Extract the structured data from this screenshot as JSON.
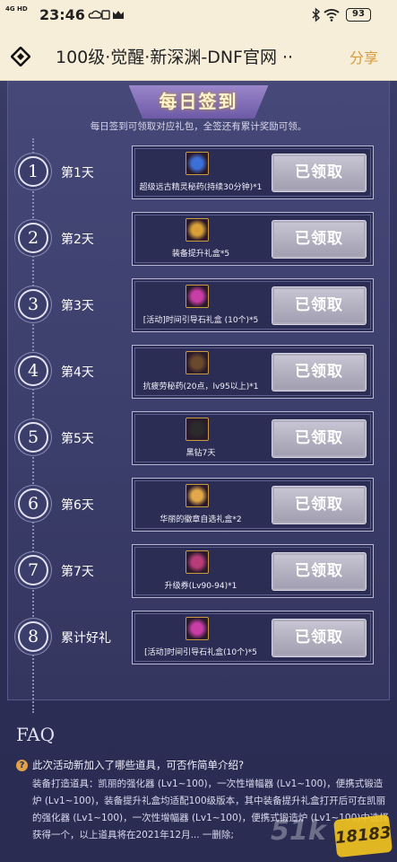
{
  "status_bar": {
    "signal": "4G HD",
    "time": "23:46",
    "battery": "93"
  },
  "title_bar": {
    "title": "100级·觉醒·新深渊-DNF官网 ··",
    "share_label": "分享"
  },
  "checkin": {
    "heading": "每日签到",
    "subtitle": "每日签到可领取对应礼包，全签还有累计奖励可领。",
    "days": [
      {
        "number": "1",
        "label": "第1天",
        "item": "超级远古精灵秘药(持续30分钟)*1",
        "button": "已领取",
        "icon_color": "#3d6fd9"
      },
      {
        "number": "2",
        "label": "第2天",
        "item": "装备提升礼盒*5",
        "button": "已领取",
        "icon_color": "#d9a037"
      },
      {
        "number": "3",
        "label": "第3天",
        "item": "[活动]时间引导石礼盒 (10个)*5",
        "button": "已领取",
        "icon_color": "#c93ea6"
      },
      {
        "number": "4",
        "label": "第4天",
        "item": "抗疲劳秘药(20点，lv95以上)*1",
        "button": "已领取",
        "icon_color": "#6a4a2c"
      },
      {
        "number": "5",
        "label": "第5天",
        "item": "黑钻7天",
        "button": "已领取",
        "icon_color": "#2b2b2b"
      },
      {
        "number": "6",
        "label": "第6天",
        "item": "华丽的徽章自选礼盒*2",
        "button": "已领取",
        "icon_color": "#e0a84a"
      },
      {
        "number": "7",
        "label": "第7天",
        "item": "升级券(Lv90-94)*1",
        "button": "已领取",
        "icon_color": "#b83c7a"
      },
      {
        "number": "8",
        "label": "累计好礼",
        "item": "[活动]时间引导石礼盒(10个)*5",
        "button": "已领取",
        "icon_color": "#c93ea6"
      }
    ]
  },
  "faq": {
    "title": "FAQ",
    "question": "此次活动新加入了哪些道具，可否作简单介绍?",
    "answer": "装备打造道具：凯丽的强化器 (Lv1~100)，一次性增幅器 (Lv1~100)，便携式锻造炉 (Lv1~100)，装备提升礼盒均适配100级版本，其中装备提升礼盒打开后可在凯丽的强化器 (Lv1~100)，一次性增幅器 (Lv1~100)，便携式锻造炉 (Lv1~100)中选择获得一个，以上道具将在2021年12月... 一删除;"
  },
  "watermark": {
    "site": "51k",
    "badge": "18183"
  }
}
